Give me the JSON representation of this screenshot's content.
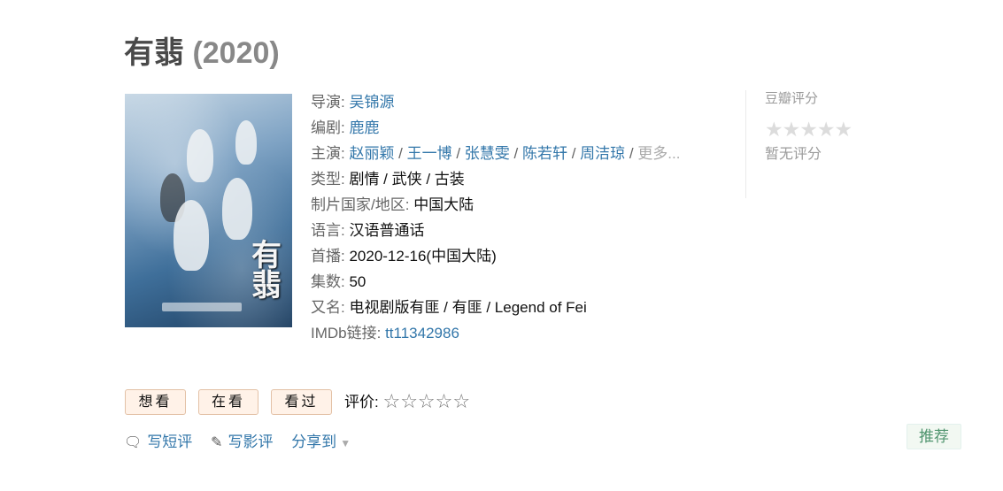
{
  "title": {
    "name": "有翡",
    "year": "(2020)"
  },
  "poster": {
    "brand_text": "有翡"
  },
  "info": {
    "director": {
      "label": "导演",
      "value": "吴锦源"
    },
    "writer": {
      "label": "编剧",
      "value": "鹿鹿"
    },
    "cast": {
      "label": "主演",
      "names": [
        "赵丽颖",
        "王一博",
        "张慧雯",
        "陈若轩",
        "周洁琼"
      ],
      "more": "更多..."
    },
    "genre": {
      "label": "类型",
      "value": "剧情 / 武侠 / 古装"
    },
    "country": {
      "label": "制片国家/地区",
      "value": "中国大陆"
    },
    "language": {
      "label": "语言",
      "value": "汉语普通话"
    },
    "premiere": {
      "label": "首播",
      "value": "2020-12-16(中国大陆)"
    },
    "episodes": {
      "label": "集数",
      "value": "50"
    },
    "aka": {
      "label": "又名",
      "value": "电视剧版有匪 / 有匪 / Legend of Fei"
    },
    "imdb": {
      "label": "IMDb链接",
      "value": "tt11342986"
    }
  },
  "rating": {
    "title": "豆瓣评分",
    "stars": "★★★★★",
    "no_rating": "暂无评分"
  },
  "buttons": {
    "want": "想看",
    "watching": "在看",
    "watched": "看过"
  },
  "evaluate": {
    "label": "评价:",
    "stars": "☆☆☆☆☆"
  },
  "actions": {
    "short_review": "写短评",
    "review": "写影评",
    "share": "分享到"
  },
  "recommend": "推荐",
  "colors": {
    "link": "#3377aa",
    "button_bg": "#fff2e8",
    "recommend_text": "#4f946e"
  }
}
